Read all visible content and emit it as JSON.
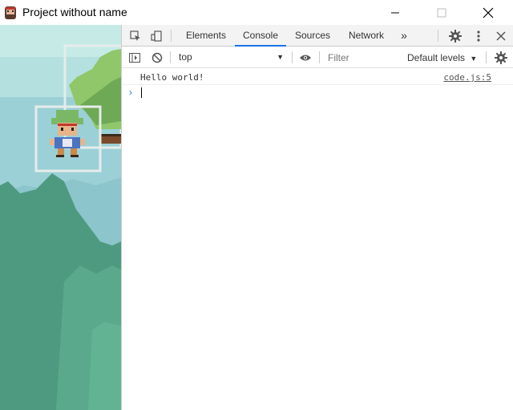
{
  "window": {
    "title": "Project without name",
    "icon": "pixel-character-app-icon",
    "minimize_icon": "minimize-icon",
    "maximize_icon": "maximize-icon",
    "close_icon": "close-icon"
  },
  "devtools": {
    "tabs": [
      {
        "label": "Elements",
        "active": false
      },
      {
        "label": "Console",
        "active": true
      },
      {
        "label": "Sources",
        "active": false
      },
      {
        "label": "Network",
        "active": false
      }
    ],
    "more_tabs_label": "»",
    "toolbar": {
      "context": "top",
      "filter_placeholder": "Filter",
      "levels_label": "Default levels"
    },
    "console": {
      "messages": [
        {
          "text": "Hello world!",
          "source": "code.js:5"
        }
      ],
      "prompt_symbol": "›"
    }
  },
  "colors": {
    "accent": "#1a73e8",
    "sky": "#a8d8dc",
    "tree_dark": "#4e9a80",
    "tree_mid": "#5aa98c",
    "tree_leaf": "#8fc76a"
  }
}
